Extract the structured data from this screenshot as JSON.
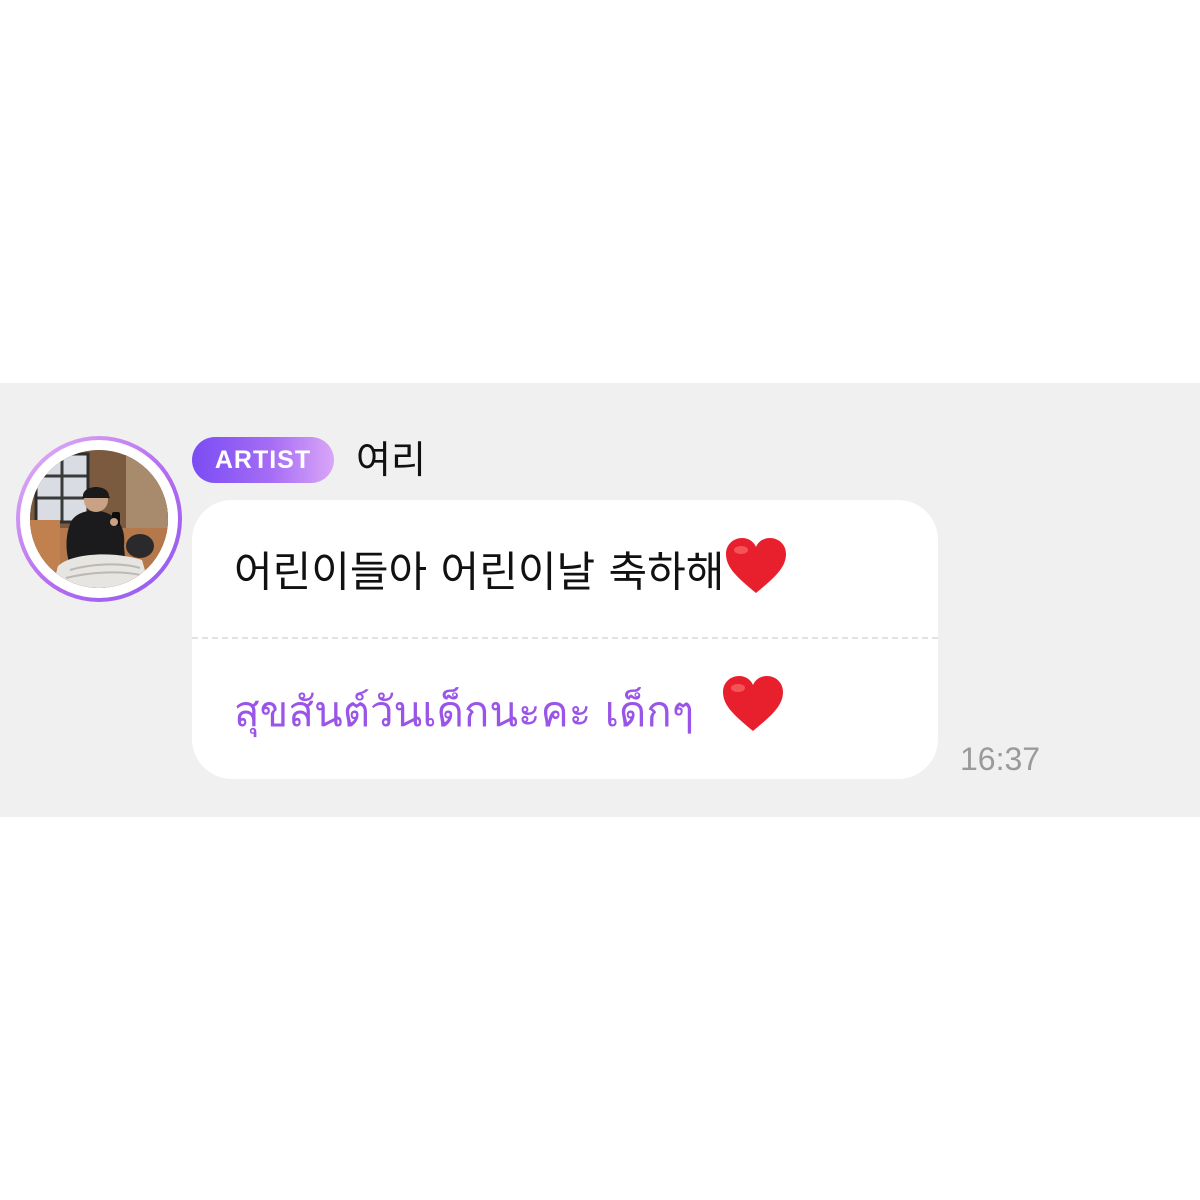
{
  "message": {
    "badge_label": "ARTIST",
    "sender_name": "여리",
    "original_text": "어린이들아 어린이날 축하해",
    "translated_text": "สุขสันต์วันเด็กนะคะ เด็กๆ",
    "timestamp": "16:37",
    "emoji_icon": "red-heart-icon"
  },
  "colors": {
    "band_background": "#f0f0f0",
    "badge_gradient_start": "#7a4cf3",
    "badge_gradient_end": "#d9a6f7",
    "translated_text": "#9a55e8",
    "timestamp": "#9a9a9a",
    "heart": "#e8202e"
  }
}
